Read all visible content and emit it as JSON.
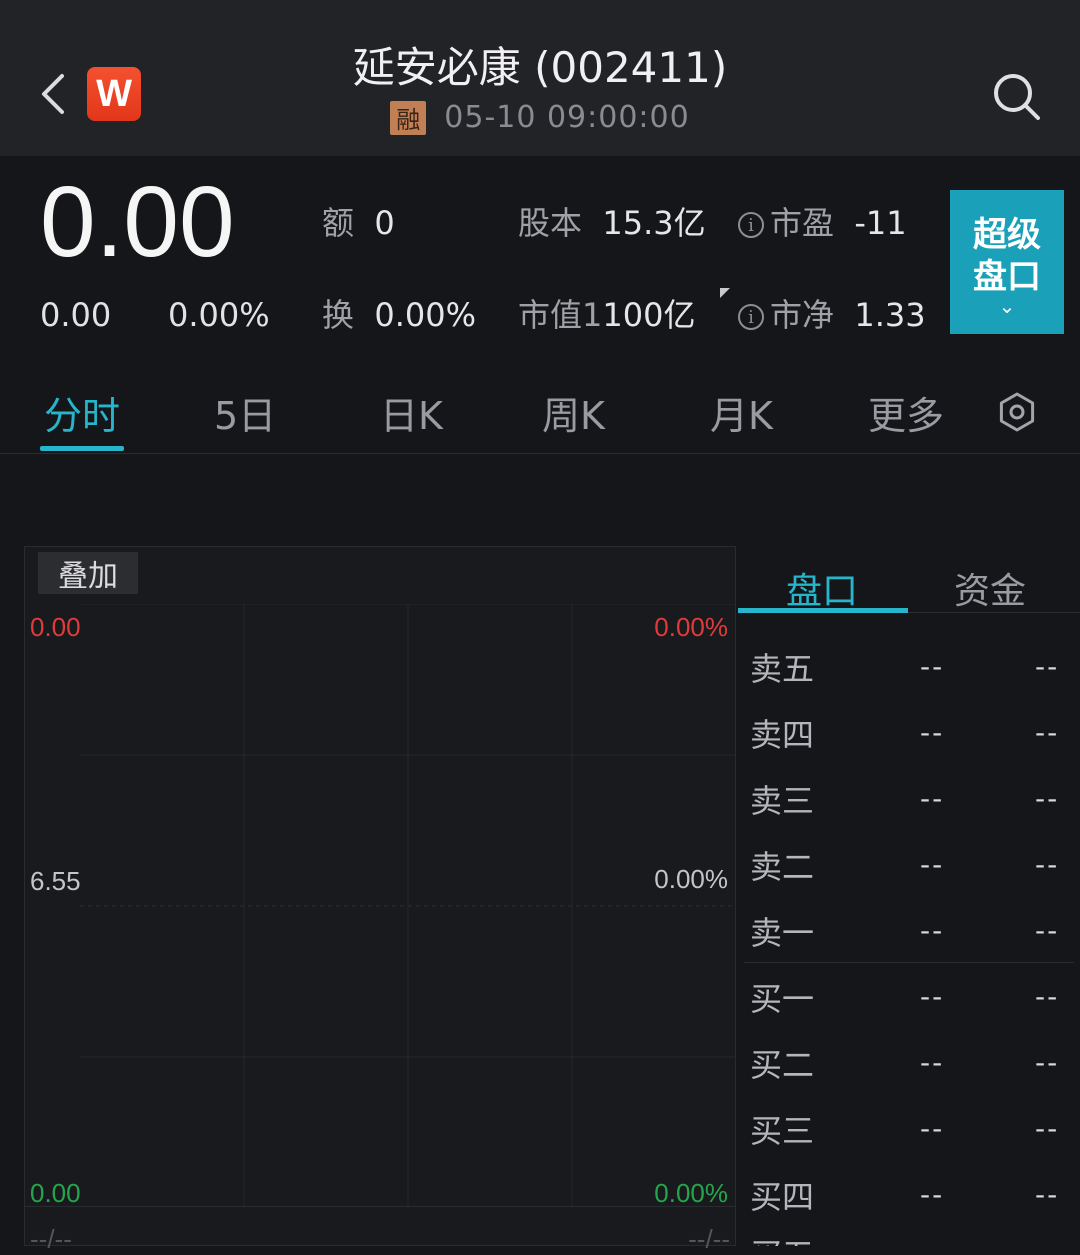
{
  "header": {
    "title": "延安必康 (002411)",
    "logo_letter": "W",
    "margin_badge": "融",
    "datetime": "05-10 09:00:00"
  },
  "quote": {
    "price": "0.00",
    "change": "0.00",
    "change_pct": "0.00%",
    "amount_label": "额",
    "amount_value": "0",
    "turnover_label": "换",
    "turnover_value": "0.00%",
    "share_cap_label": "股本",
    "share_cap_value": "15.3亿",
    "mkt_cap_label": "市值1",
    "mkt_cap_value": "100亿",
    "pe_label": "市盈",
    "pe_value": "-11",
    "pb_label": "市净",
    "pb_value": "1.33",
    "super_button_line1": "超级",
    "super_button_line2": "盘口",
    "super_button_chevron": "⌄"
  },
  "tabs": [
    {
      "label": "分时",
      "active": true
    },
    {
      "label": "5日"
    },
    {
      "label": "日K"
    },
    {
      "label": "周K"
    },
    {
      "label": "月K"
    },
    {
      "label": "更多"
    }
  ],
  "chart": {
    "overlay_label": "叠加",
    "left_axis": [
      "0.00",
      "6.55",
      "0.00"
    ],
    "right_axis": [
      "0.00%",
      "0.00%",
      "0.00%"
    ],
    "time_left": "--/--",
    "time_right": "--/--",
    "colors": {
      "up": "#e03a3a",
      "down": "#25a54b",
      "accent": "#27b5cc"
    }
  },
  "orderbook": {
    "tabs": [
      "盘口",
      "资金"
    ],
    "rows": [
      {
        "label": "卖五",
        "price": "--",
        "volume": "--"
      },
      {
        "label": "卖四",
        "price": "--",
        "volume": "--"
      },
      {
        "label": "卖三",
        "price": "--",
        "volume": "--"
      },
      {
        "label": "卖二",
        "price": "--",
        "volume": "--"
      },
      {
        "label": "卖一",
        "price": "--",
        "volume": "--"
      },
      {
        "label": "买一",
        "price": "--",
        "volume": "--"
      },
      {
        "label": "买二",
        "price": "--",
        "volume": "--"
      },
      {
        "label": "买三",
        "price": "--",
        "volume": "--"
      },
      {
        "label": "买四",
        "price": "--",
        "volume": "--"
      },
      {
        "label": "买五",
        "price": "--",
        "volume": "--"
      }
    ]
  },
  "icons": {
    "back": "chevron-left-icon",
    "search": "search-icon",
    "settings": "gear-icon",
    "info": "info-icon"
  }
}
